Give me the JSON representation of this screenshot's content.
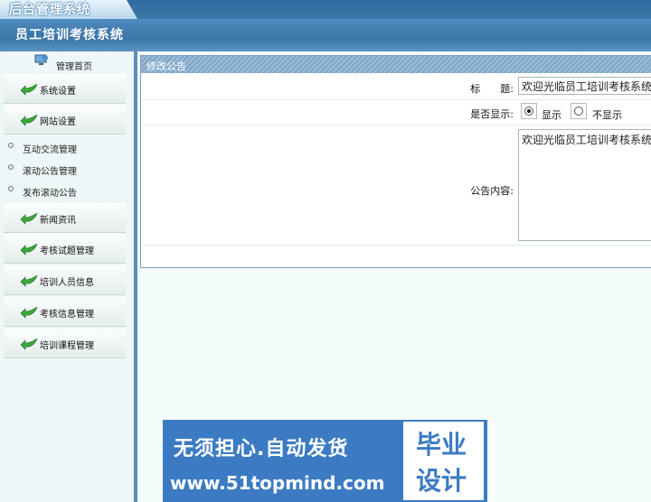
{
  "top_tab": {
    "label": "后台管理系统"
  },
  "header": {
    "title": "员工培训考核系统"
  },
  "sidebar": {
    "home_label": "管理首页",
    "items": [
      {
        "label": "系统设置"
      },
      {
        "label": "网站设置"
      }
    ],
    "sub_items": [
      {
        "label": "互动交流管理"
      },
      {
        "label": "滚动公告管理"
      },
      {
        "label": "发布滚动公告"
      }
    ],
    "items2": [
      {
        "label": "新闻资讯"
      },
      {
        "label": "考核试题管理"
      },
      {
        "label": "培训人员信息"
      },
      {
        "label": "考核信息管理"
      },
      {
        "label": "培训课程管理"
      }
    ]
  },
  "panel": {
    "title": "修改公告",
    "title_label": "标　　题:",
    "title_value": "欢迎光临员工培训考核系统",
    "show_label": "是否显示:",
    "show_options": [
      "显示",
      "不显示"
    ],
    "show_selected": "显示",
    "content_label": "公告内容:",
    "content_value": "欢迎光临员工培训考核系统"
  },
  "banner": {
    "slogan": "无须担心.自动发货",
    "url": "www.51topmind.com",
    "box_line1": "毕业",
    "box_line2": "设计"
  },
  "colors": {
    "header": "#3b74a6",
    "panel_title": "#8ab0d0",
    "banner": "#3c7bc3"
  }
}
